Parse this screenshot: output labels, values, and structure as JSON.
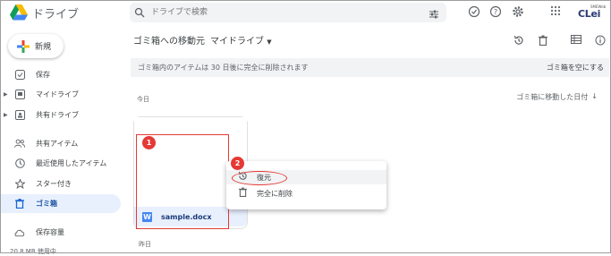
{
  "header": {
    "app_name": "ドライブ",
    "search_placeholder": "ドライブで検索",
    "brand_logo_text": "CLei",
    "brand_small_text": "SMEWeb"
  },
  "sidebar": {
    "new_button": "新規",
    "items": [
      {
        "label": "保存"
      },
      {
        "label": "マイドライブ"
      },
      {
        "label": "共有ドライブ"
      },
      {
        "label": "共有アイテム"
      },
      {
        "label": "最近使用したアイテム"
      },
      {
        "label": "スター付き"
      },
      {
        "label": "ゴミ箱"
      },
      {
        "label": "保存容量"
      }
    ],
    "storage_used": "20.8 MB 使用中"
  },
  "main": {
    "breadcrumb": "ゴミ箱への移動元",
    "breadcrumb_location": "マイドライブ",
    "notice": "ゴミ箱内のアイテムは 30 日後に完全に削除されます",
    "empty_trash": "ゴミ箱を空にする",
    "section_today": "今日",
    "section_yesterday": "昨日",
    "sort_label": "ゴミ箱に移動した日付",
    "file_name": "sample.docx",
    "file_icon_letter": "W"
  },
  "context_menu": {
    "restore": "復元",
    "delete_forever": "完全に削除"
  },
  "callouts": {
    "one": "1",
    "two": "2"
  },
  "colors": {
    "accent_blue": "#1967d2",
    "callout_red": "#e53935",
    "active_bg": "#e8f0fe"
  }
}
